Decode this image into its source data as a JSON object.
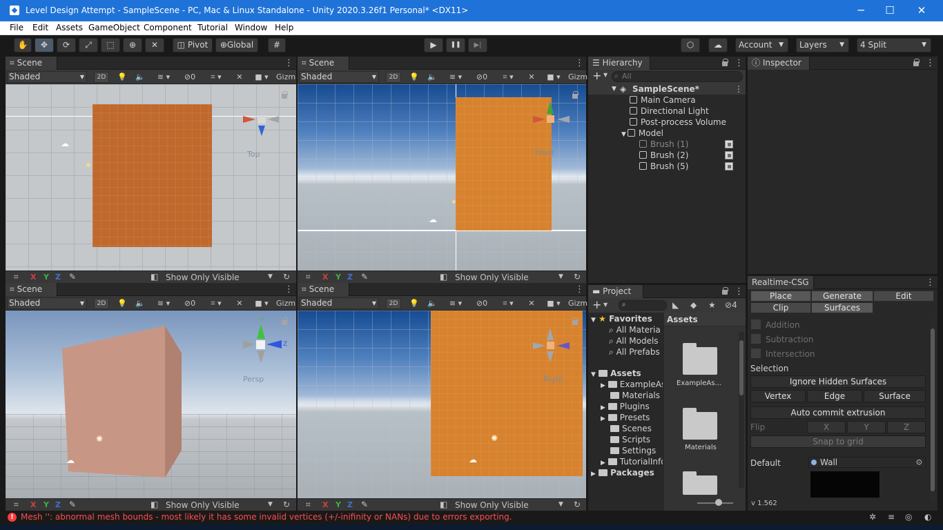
{
  "window": {
    "title": "Level Design Attempt - SampleScene - PC, Mac & Linux Standalone - Unity 2020.3.26f1 Personal* <DX11>",
    "minimize": "─",
    "maximize": "☐",
    "close": "✕"
  },
  "menu": [
    "File",
    "Edit",
    "Assets",
    "GameObject",
    "Component",
    "Tutorial",
    "Window",
    "Help"
  ],
  "toolbar": {
    "pivot": "Pivot",
    "global": "Global",
    "play": "▶",
    "pause": "❚❚",
    "step": "▶|",
    "account": "Account",
    "layers": "Layers",
    "layout": "4 Split"
  },
  "scene_views": [
    {
      "tab": "Scene",
      "shading": "Shaded",
      "twod": "2D",
      "hidden_count": "0",
      "gizmos": "Gizm",
      "gizmo_label": "Top",
      "bottom_label": "Show Only Visible"
    },
    {
      "tab": "Scene",
      "shading": "Shaded",
      "twod": "2D",
      "hidden_count": "0",
      "gizmos": "Gizm",
      "gizmo_label": "Front",
      "bottom_label": "Show Only Visible"
    },
    {
      "tab": "Scene",
      "shading": "Shaded",
      "twod": "2D",
      "hidden_count": "0",
      "gizmos": "Gizm",
      "gizmo_label": "Persp",
      "bottom_label": "Show Only Visible"
    },
    {
      "tab": "Scene",
      "shading": "Shaded",
      "twod": "2D",
      "hidden_count": "0",
      "gizmos": "Gizm",
      "gizmo_label": "Right",
      "bottom_label": "Show Only Visible"
    }
  ],
  "axis": {
    "x": "X",
    "y": "Y",
    "z": "Z"
  },
  "hierarchy": {
    "tab": "Hierarchy",
    "search_placeholder": "All",
    "scene": "SampleScene*",
    "items": [
      {
        "label": "Main Camera",
        "dim": false
      },
      {
        "label": "Directional Light",
        "dim": false
      },
      {
        "label": "Post-process Volume",
        "dim": false
      },
      {
        "label": "Model",
        "dim": false
      },
      {
        "label": "Brush (1)",
        "dim": true
      },
      {
        "label": "Brush (2)",
        "dim": false
      },
      {
        "label": "Brush (5)",
        "dim": false
      }
    ]
  },
  "project": {
    "tab": "Project",
    "hidden_count": "4",
    "favorites": "Favorites",
    "favorite_items": [
      "All Materia",
      "All Models",
      "All Prefabs"
    ],
    "assets": "Assets",
    "asset_folders": [
      "ExampleAs",
      "Materials",
      "Plugins",
      "Presets",
      "Scenes",
      "Scripts",
      "Settings",
      "TutorialInfo"
    ],
    "packages": "Packages",
    "breadcrumb": "Assets",
    "grid_items": [
      "ExampleAs...",
      "Materials"
    ]
  },
  "inspector": {
    "tab": "Inspector"
  },
  "csg": {
    "tab": "Realtime-CSG",
    "modes": [
      "Place",
      "Generate",
      "Edit",
      "Clip",
      "Surfaces"
    ],
    "operations": [
      "Addition",
      "Subtraction",
      "Intersection"
    ],
    "selection_label": "Selection",
    "ignore_hidden": "Ignore Hidden Surfaces",
    "select_modes": [
      "Vertex",
      "Edge",
      "Surface"
    ],
    "auto_commit": "Auto commit extrusion",
    "flip_label": "Flip",
    "flip_axes": [
      "X",
      "Y",
      "Z"
    ],
    "snap": "Snap to grid",
    "default_label": "Default",
    "default_material": "Wall",
    "version": "v 1.562"
  },
  "status": {
    "message": "Mesh '': abnormal mesh bounds - most likely it has some invalid vertices (+/-inifinity or NANs) due to errors exporting."
  }
}
